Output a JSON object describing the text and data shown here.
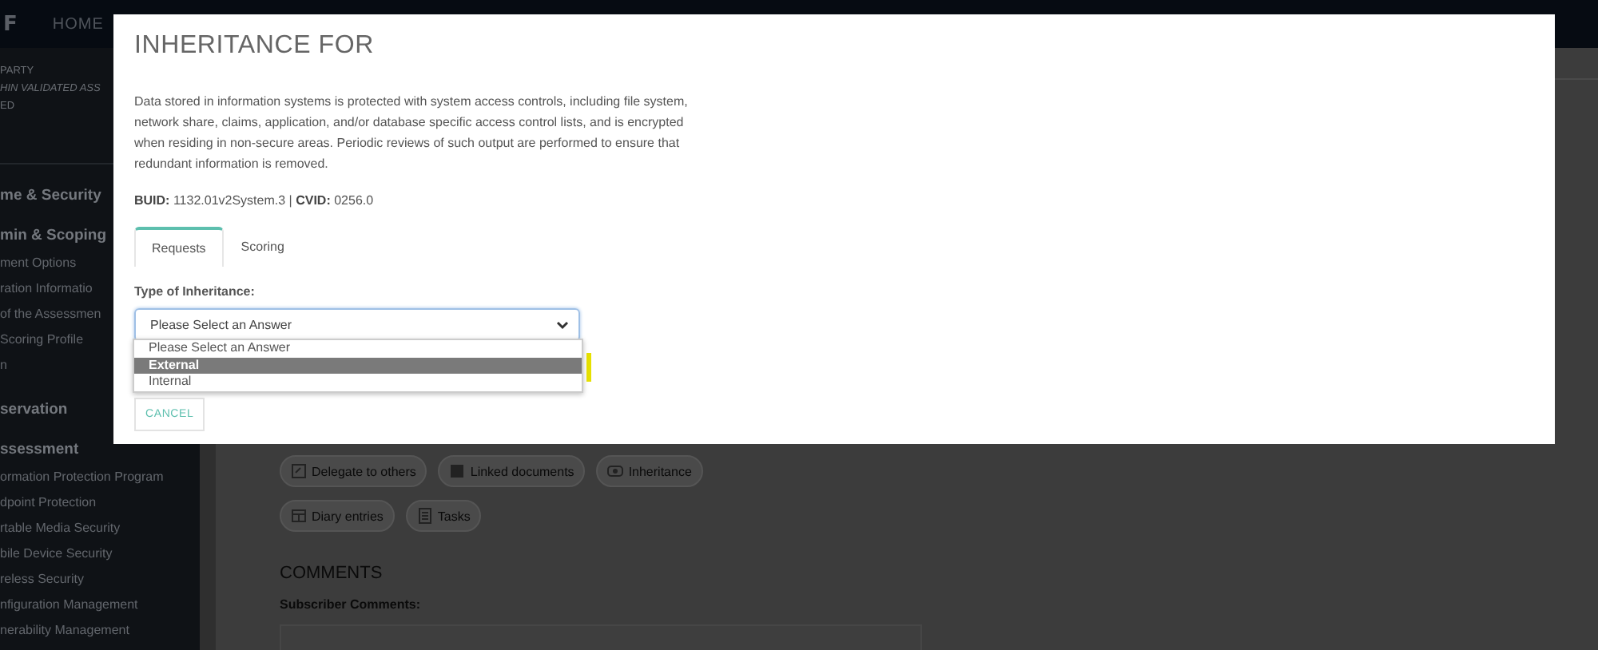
{
  "top_bar": {
    "logo": "F",
    "nav": [
      "HOME"
    ]
  },
  "sidebar": {
    "header_lines": [
      "PARTY",
      "HIN VALIDATED ASS",
      "ED"
    ],
    "sections": [
      {
        "title": "me & Security"
      },
      {
        "title": "min & Scoping",
        "items": [
          "ment Options",
          "ration Informatio",
          "of the Assessmen",
          "Scoring Profile",
          "n"
        ]
      },
      {
        "title": "servation"
      },
      {
        "title": "ssessment",
        "items": [
          "ormation Protection Program",
          "dpoint Protection",
          "rtable Media Security",
          "bile Device Security",
          "reless Security",
          "nfiguration Management",
          "nerability Management"
        ]
      }
    ]
  },
  "main": {
    "actions": [
      {
        "label": "Delegate to others",
        "kind": "delegate"
      },
      {
        "label": "Linked documents",
        "kind": "documents"
      },
      {
        "label": "Inheritance",
        "kind": "inheritance"
      },
      {
        "label": "Diary entries",
        "kind": "diary"
      },
      {
        "label": "Tasks",
        "kind": "tasks"
      }
    ],
    "comments_heading": "COMMENTS",
    "subscriber_label": "Subscriber Comments:"
  },
  "modal": {
    "title": "INHERITANCE FOR",
    "description": "Data stored in information systems is protected with system access controls, including file system, network share, claims, application, and/or database specific access control lists, and is encrypted when residing in non-secure areas. Periodic reviews of such output are performed to ensure that redundant information is removed.",
    "ids": "**BUID:** 1132.01v2System.3 | **CVID:** 0256.0",
    "tabs": [
      {
        "label": "Requests",
        "selected": true
      },
      {
        "label": "Scoring",
        "selected": false
      }
    ],
    "field_label": "Type of Inheritance:",
    "select": {
      "value": "Please Select an Answer",
      "expanded": true,
      "options": [
        {
          "label": "Please Select an Answer",
          "highlighted": false
        },
        {
          "label": "External",
          "highlighted": true
        },
        {
          "label": "Internal",
          "highlighted": false
        }
      ]
    },
    "cancel_button": "CANCEL"
  }
}
